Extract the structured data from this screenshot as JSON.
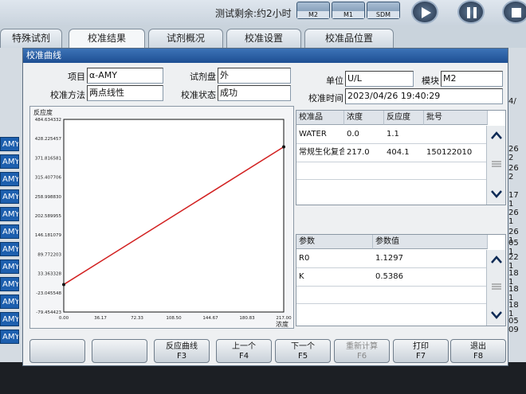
{
  "status": {
    "text": "测试剩余:约2小时"
  },
  "modules": [
    {
      "label": "M2"
    },
    {
      "label": "M1"
    },
    {
      "label": "SDM"
    }
  ],
  "tabs": [
    {
      "label": "特殊试剂"
    },
    {
      "label": "校准结果"
    },
    {
      "label": "试剂概况"
    },
    {
      "label": "校准设置"
    },
    {
      "label": "校准品位置"
    }
  ],
  "background": {
    "left_rows": [
      "AMY",
      "AMY",
      "AMY",
      "AMY",
      "AMY",
      "AMY",
      "AMY",
      "AMY",
      "AMY",
      "AMY",
      "AMY",
      "AMY"
    ],
    "right_rows": [
      "4/",
      "26 2",
      "26 2",
      "17 1",
      "26 1",
      "26 1",
      "05 1",
      "22 1",
      "18 1",
      "18 1",
      "18 1",
      "05 09"
    ]
  },
  "dialog": {
    "title": "校准曲线",
    "fields": {
      "item_label": "项目",
      "item_value": "α-AMY",
      "disk_label": "试剂盘",
      "disk_value": "外",
      "unit_label": "单位",
      "unit_value": "U/L",
      "module_label": "模块",
      "module_value": "M2",
      "method_label": "校准方法",
      "method_value": "两点线性",
      "state_label": "校准状态",
      "state_value": "成功",
      "time_label": "校准时间",
      "time_value": "2023/04/26 19:40:29"
    }
  },
  "chart_data": {
    "type": "line",
    "ylabel": "反应度",
    "xlabel": "浓度",
    "y_ticks": [
      "484.634332",
      "428.225457",
      "371.816581",
      "315.407706",
      "258.998830",
      "202.589955",
      "146.181079",
      "89.772203",
      "33.363328",
      "-23.045548",
      "-79.454423"
    ],
    "x_ticks": [
      "0.00",
      "36.17",
      "72.33",
      "108.50",
      "144.67",
      "180.83",
      "217.00"
    ],
    "xlim": [
      0,
      217
    ],
    "ylim": [
      -79.454423,
      484.634332
    ],
    "series": [
      {
        "color": "#d22020",
        "points": [
          [
            0.0,
            1.1
          ],
          [
            217.0,
            404.1
          ]
        ]
      }
    ]
  },
  "calib_table": {
    "headers": [
      "校准品",
      "浓度",
      "反应度",
      "批号"
    ],
    "rows": [
      [
        "WATER",
        "0.0",
        "1.1",
        ""
      ],
      [
        "常规生化复合...",
        "217.0",
        "404.1",
        "150122010"
      ]
    ]
  },
  "param_table": {
    "headers": [
      "参数",
      "参数值"
    ],
    "rows": [
      [
        "R0",
        "1.1297"
      ],
      [
        "K",
        "0.5386"
      ]
    ]
  },
  "buttons": [
    {
      "label": "",
      "key": ""
    },
    {
      "label": "",
      "key": ""
    },
    {
      "label": "反应曲线",
      "key": "F3"
    },
    {
      "label": "上一个",
      "key": "F4"
    },
    {
      "label": "下一个",
      "key": "F5"
    },
    {
      "label": "重新计算",
      "key": "F6"
    },
    {
      "label": "打印",
      "key": "F7"
    },
    {
      "label": "退出",
      "key": "F8"
    }
  ]
}
